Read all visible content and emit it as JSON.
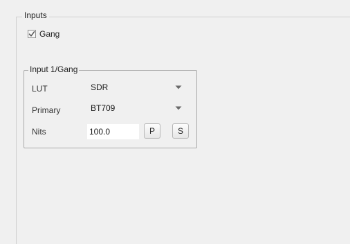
{
  "inputs_group": {
    "title": "Inputs",
    "gang_checkbox": {
      "label": "Gang",
      "checked": true
    }
  },
  "input_group": {
    "title": "Input 1/Gang",
    "lut": {
      "label": "LUT",
      "value": "SDR"
    },
    "primary": {
      "label": "Primary",
      "value": "BT709"
    },
    "nits": {
      "label": "Nits",
      "value": "100.0"
    },
    "p_button_label": "P",
    "s_button_label": "S"
  },
  "icons": {
    "checkmark": "check-icon",
    "dropdown": "dropdown-arrow-icon"
  }
}
